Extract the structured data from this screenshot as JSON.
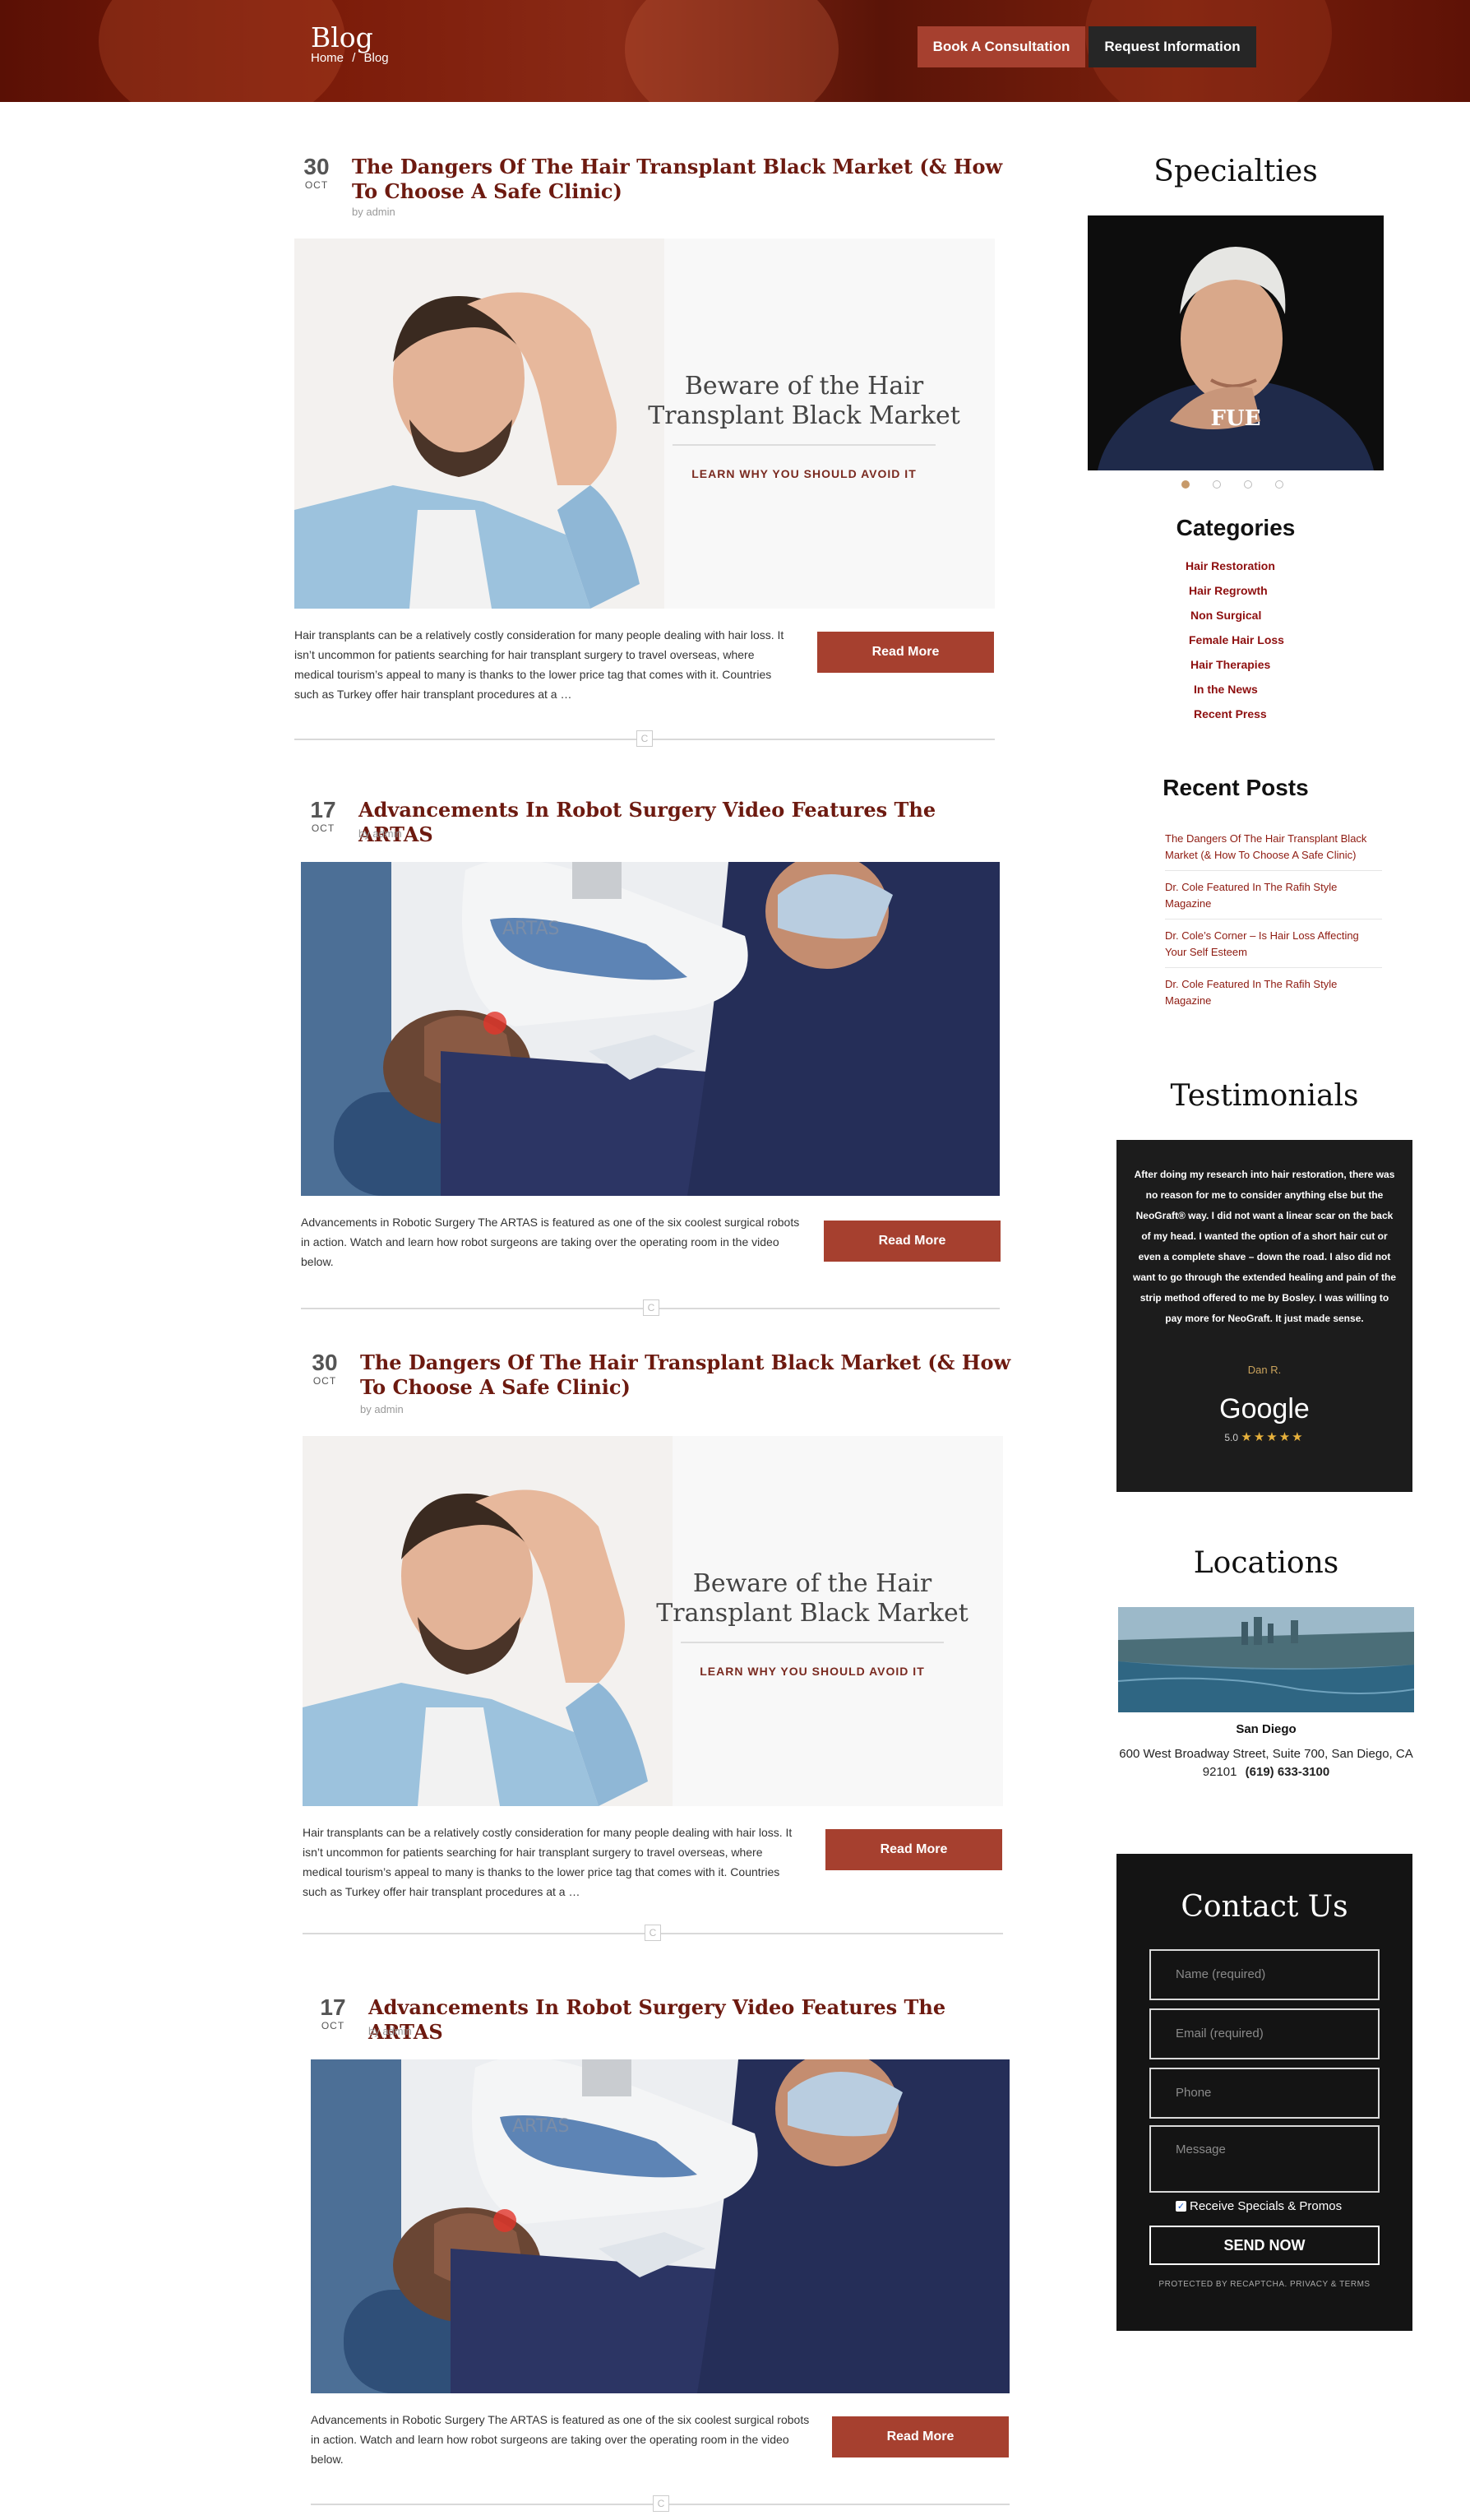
{
  "header": {
    "title": "Blog",
    "breadcrumb": [
      "Home",
      "/",
      "Blog"
    ],
    "buttons": {
      "book": "Book A Consultation",
      "info": "Request Information"
    }
  },
  "posts": [
    {
      "day": "30",
      "month": "OCT",
      "title": "The Dangers Of The Hair Transplant Black Market (& How To Choose A Safe Clinic)",
      "byline": "by admin",
      "image": {
        "headline": "Beware of the Hair Transplant Black Market",
        "cta": "LEARN WHY YOU SHOULD AVOID IT"
      },
      "excerpt": "Hair transplants can be a relatively costly consideration for many people dealing with hair loss. It isn’t uncommon for patients searching for hair transplant surgery to travel overseas, where medical tourism’s appeal to many is thanks to the lower price tag that comes with it. Countries such as Turkey offer hair transplant procedures at a …",
      "read_more": "Read More"
    },
    {
      "day": "17",
      "month": "OCT",
      "title": "Advancements In Robot Surgery Video Features The ARTAS",
      "byline": "by admin",
      "image": {
        "brand": "ARTAS"
      },
      "excerpt": "Advancements in Robotic Surgery The ARTAS is featured as one of the six coolest surgical robots in action. Watch and learn how robot surgeons are taking over the operating room in the video below.",
      "read_more": "Read More"
    },
    {
      "day": "30",
      "month": "OCT",
      "title": "The Dangers Of The Hair Transplant Black Market (& How To Choose A Safe Clinic)",
      "byline": "by admin",
      "image": {
        "headline": "Beware of the Hair Transplant Black Market",
        "cta": "LEARN WHY YOU SHOULD AVOID IT"
      },
      "excerpt": "Hair transplants can be a relatively costly consideration for many people dealing with hair loss. It isn’t uncommon for patients searching for hair transplant surgery to travel overseas, where medical tourism’s appeal to many is thanks to the lower price tag that comes with it. Countries such as Turkey offer hair transplant procedures at a …",
      "read_more": "Read More"
    },
    {
      "day": "17",
      "month": "OCT",
      "title": "Advancements In Robot Surgery Video Features The ARTAS",
      "byline": "by admin",
      "image": {
        "brand": "ARTAS"
      },
      "excerpt": "Advancements in Robotic Surgery The ARTAS is featured as one of the six coolest surgical robots in action. Watch and learn how robot surgeons are taking over the operating room in the video below.",
      "read_more": "Read More"
    }
  ],
  "divider_logo": "C",
  "sidebar": {
    "specialties": {
      "title": "Specialties",
      "slide_label": "FUE",
      "slides_total": 4,
      "active_slide": 1
    },
    "categories": {
      "title": "Categories",
      "items": [
        "Hair Restoration",
        "Hair Regrowth",
        "Non Surgical",
        "Female Hair Loss",
        "Hair Therapies",
        "In the News",
        "Recent Press"
      ]
    },
    "recent_posts": {
      "title": "Recent Posts",
      "items": [
        "The Dangers Of The Hair Transplant Black Market (& How To Choose A Safe Clinic)",
        "Dr. Cole Featured In The Rafih Style Magazine",
        "Dr. Cole’s Corner – Is Hair Loss Affecting Your Self Esteem",
        "Dr. Cole Featured In The Rafih Style Magazine"
      ]
    },
    "testimonials": {
      "title": "Testimonials",
      "quote": "After doing my research into hair restoration, there was no reason for me to consider anything else but the NeoGraft® way. I did not want a linear scar on the back of my head. I wanted the option of a short hair cut or even a complete shave – down the road. I also did not want to go through the extended healing and pain of the strip method offered to me by Bosley. I was willing to pay more for NeoGraft. It just made sense.",
      "author": "Dan R.",
      "source": "Google",
      "rating": "5.0",
      "stars": "★★★★★"
    },
    "locations": {
      "title": "Locations",
      "city": "San Diego",
      "address": "600 West Broadway Street, Suite 700, San Diego, CA 92101",
      "phone": "(619) 633-3100"
    },
    "contact": {
      "title": "Contact Us",
      "name_placeholder": "Name (required)",
      "email_placeholder": "Email (required)",
      "phone_placeholder": "Phone",
      "message_placeholder": "Message",
      "checkbox_label": "Receive Specials & Promos",
      "checkbox_checked": true,
      "submit": "SEND NOW",
      "recaptcha": "PROTECTED BY RECAPTCHA. PRIVACY & TERMS"
    }
  },
  "colors": {
    "brand": "#a6402f",
    "title": "#6d1a10",
    "link": "#8e0f0f",
    "dark": "#1c1c1c"
  }
}
